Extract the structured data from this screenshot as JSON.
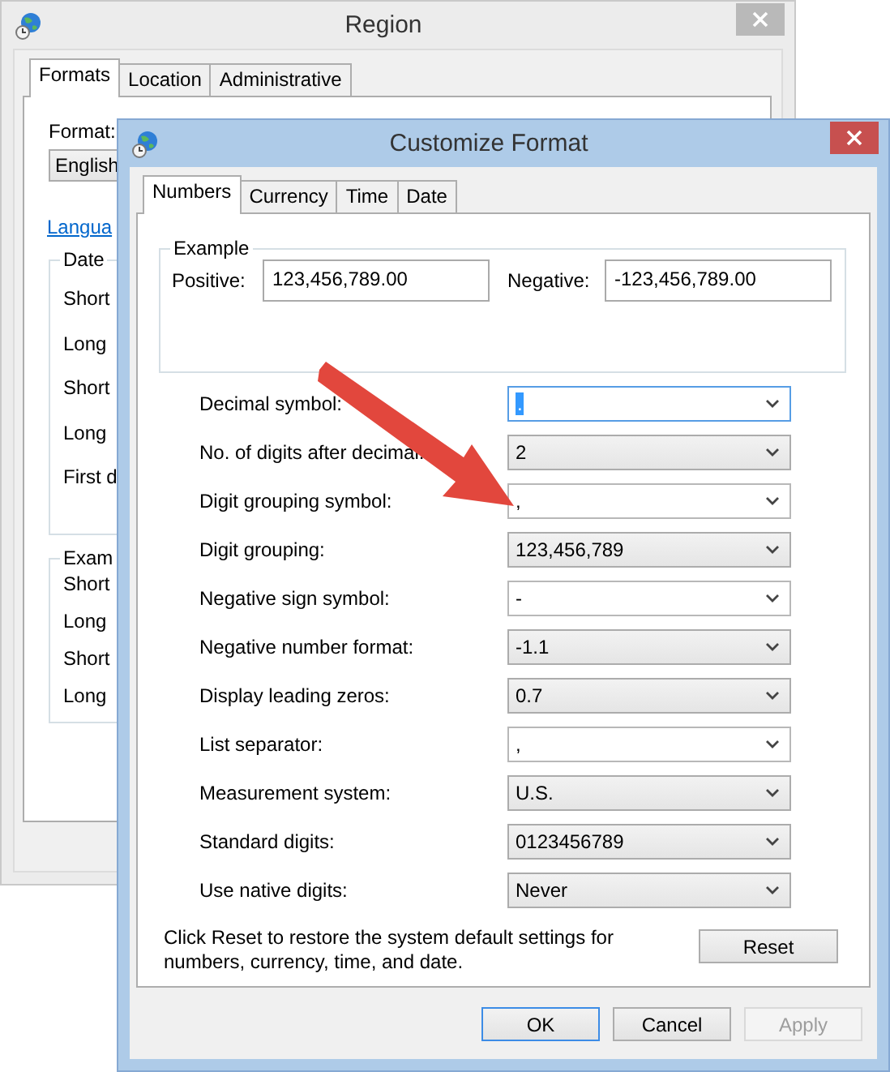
{
  "region_window": {
    "title": "Region",
    "active": false,
    "tabs": [
      {
        "label": "Formats",
        "selected": true
      },
      {
        "label": "Location",
        "selected": false
      },
      {
        "label": "Administrative",
        "selected": false
      }
    ],
    "format_label": "Format:",
    "format_value": "English",
    "language_link": "Langua",
    "date_group": {
      "title": "Date",
      "rows": [
        "Short",
        "Long",
        "Short",
        "Long",
        "First d"
      ]
    },
    "examples_group": {
      "title": "Exam",
      "rows": [
        "Short",
        "Long",
        "Short",
        "Long"
      ]
    }
  },
  "customize_window": {
    "title": "Customize Format",
    "active": true,
    "tabs": [
      {
        "label": "Numbers",
        "selected": true
      },
      {
        "label": "Currency",
        "selected": false
      },
      {
        "label": "Time",
        "selected": false
      },
      {
        "label": "Date",
        "selected": false
      }
    ],
    "example": {
      "title": "Example",
      "positive_label": "Positive:",
      "positive_value": "123,456,789.00",
      "negative_label": "Negative:",
      "negative_value": "-123,456,789.00"
    },
    "settings": [
      {
        "label": "Decimal symbol:",
        "value": ".",
        "kind": "editable",
        "focused": true
      },
      {
        "label": "No. of digits after decimal:",
        "value": "2",
        "kind": "dropdown",
        "focused": false
      },
      {
        "label": "Digit grouping symbol:",
        "value": ",",
        "kind": "editable",
        "focused": false
      },
      {
        "label": "Digit grouping:",
        "value": "123,456,789",
        "kind": "dropdown",
        "focused": false
      },
      {
        "label": "Negative sign symbol:",
        "value": "-",
        "kind": "editable",
        "focused": false
      },
      {
        "label": "Negative number format:",
        "value": "-1.1",
        "kind": "dropdown",
        "focused": false
      },
      {
        "label": "Display leading zeros:",
        "value": "0.7",
        "kind": "dropdown",
        "focused": false
      },
      {
        "label": "List separator:",
        "value": ",",
        "kind": "editable",
        "focused": false
      },
      {
        "label": "Measurement system:",
        "value": "U.S.",
        "kind": "dropdown",
        "focused": false
      },
      {
        "label": "Standard digits:",
        "value": "0123456789",
        "kind": "dropdown",
        "focused": false
      },
      {
        "label": "Use native digits:",
        "value": "Never",
        "kind": "dropdown",
        "focused": false
      }
    ],
    "reset_note": "Click Reset to restore the system default settings for numbers, currency, time, and date.",
    "reset_button": "Reset",
    "dialog_buttons": [
      {
        "label": "OK",
        "default": true,
        "disabled": false
      },
      {
        "label": "Cancel",
        "default": false,
        "disabled": false
      },
      {
        "label": "Apply",
        "default": false,
        "disabled": true
      }
    ]
  }
}
